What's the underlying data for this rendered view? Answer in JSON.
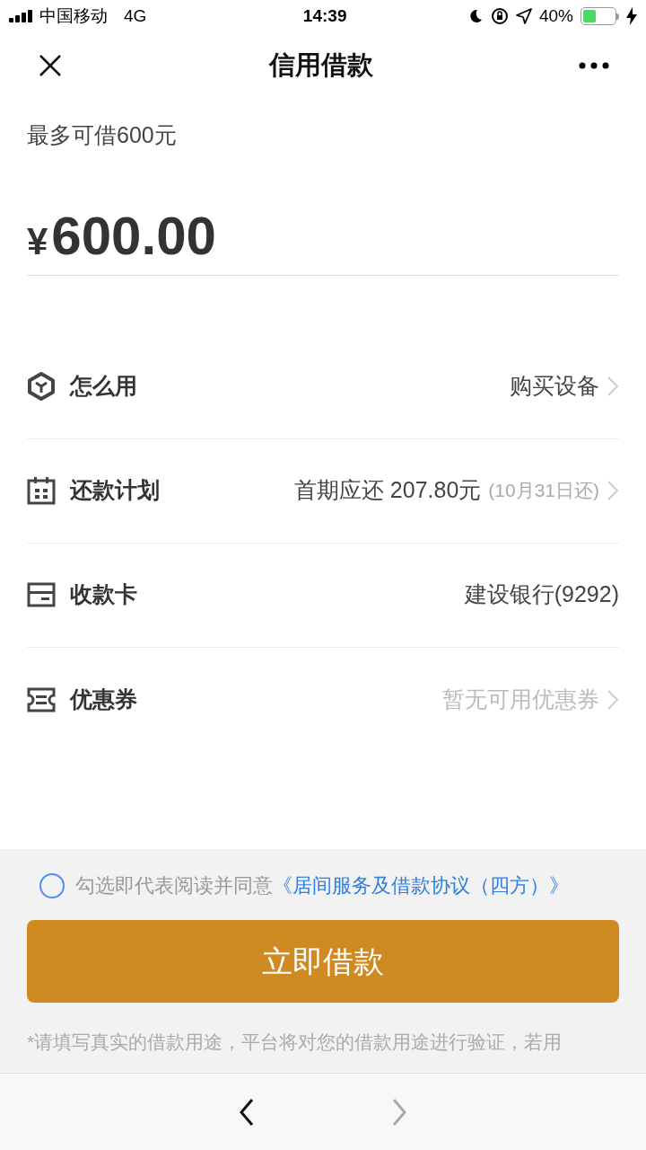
{
  "status_bar": {
    "carrier": "中国移动",
    "network": "4G",
    "time": "14:39",
    "battery": "40%"
  },
  "nav": {
    "title": "信用借款"
  },
  "limit_text": "最多可借600元",
  "amount": {
    "currency": "¥",
    "value": "600.00"
  },
  "rows": [
    {
      "kind": "cube",
      "label": "怎么用",
      "value": "购买设备",
      "muted": false,
      "chevron": true
    },
    {
      "kind": "calendar",
      "label": "还款计划",
      "value": "首期应还 207.80元",
      "sub": "(10月31日还)",
      "muted": false,
      "chevron": true
    },
    {
      "kind": "card",
      "label": "收款卡",
      "value": "建设银行(9292)",
      "muted": false,
      "chevron": false
    },
    {
      "kind": "ticket",
      "label": "优惠券",
      "value": "暂无可用优惠券",
      "muted": true,
      "chevron": true
    }
  ],
  "agreement": {
    "checked": false,
    "text": "勾选即代表阅读并同意",
    "link": "《居间服务及借款协议（四方）》"
  },
  "submit": "立即借款",
  "note": "*请填写真实的借款用途，平台将对您的借款用途进行验证，若用",
  "browser_bar": {
    "back_disabled": false,
    "forward_disabled": true
  }
}
